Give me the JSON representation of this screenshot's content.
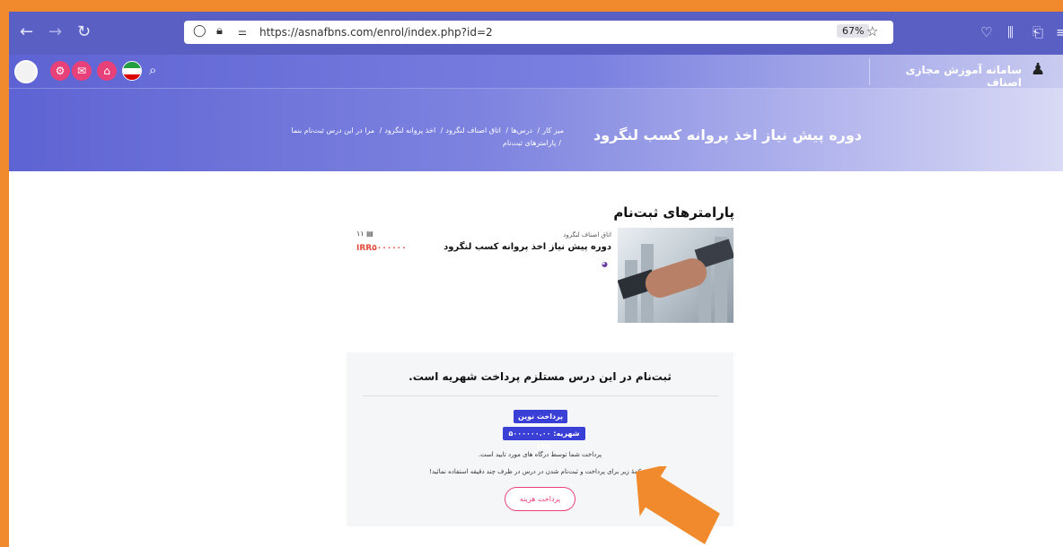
{
  "browser": {
    "back_icon": "back-arrow-icon",
    "forward_icon": "forward-arrow-icon",
    "reload_icon": "reload-icon",
    "url": "https://asnafbns.com/enrol/index.php?id=2",
    "zoom": "67%"
  },
  "header": {
    "site_title": "سامانه آموزش مجازی اصناف",
    "accent_color": "#e8417a"
  },
  "hero": {
    "course_title": "دوره پیش نیاز اخذ پروانه کسب لنگرود",
    "breadcrumb": [
      "میز کار",
      "درس‌ها",
      "اتاق اصناف لنگرود",
      "اخذ پروانه لنگرود",
      "مرا در این درس ثبت‌نام بنما",
      "پارامترهای ثبت‌نام"
    ]
  },
  "main": {
    "heading": "پارامترهای ثبت‌نام",
    "course_category": "اتاق اصناف لنگرود",
    "course_name": "دوره پیش نیاز اخذ پروانه کسب لنگرود",
    "enrol_count": "۱۱",
    "price": "IRR۵۰۰۰۰۰۰"
  },
  "payment": {
    "title": "ثبت‌نام در این درس مستلزم پرداخت شهریه است.",
    "instant_label": "پرداخت نوین",
    "fee_label": "شهریه: ۵۰۰۰۰۰۰.۰۰ IRR",
    "note": "پرداخت شما توسط درگاه های مورد تایید است.",
    "instruction": "از دکمهٔ زیر برای پرداخت و ثبت‌نام شدن در درس در ظرف چند دقیقه استفاده نمائید!",
    "button_label": "پرداخت هزینه",
    "button_color": "#e8417a",
    "badge_color": "#3a3fd6"
  },
  "annotation": {
    "arrow_color": "#f08a2c"
  }
}
